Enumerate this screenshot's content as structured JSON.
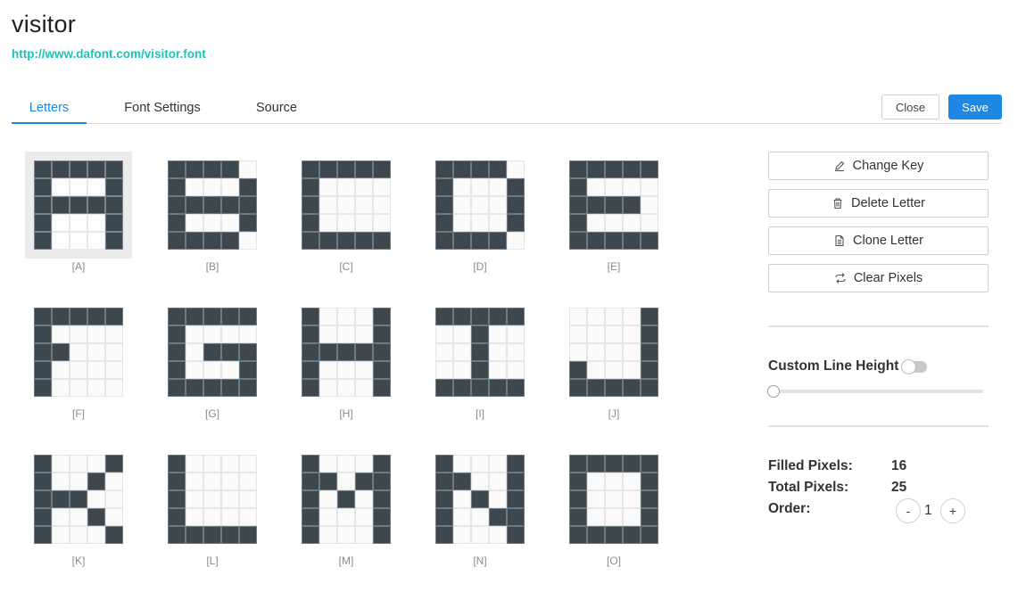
{
  "header": {
    "title": "visitor",
    "link": "http://www.dafont.com/visitor.font"
  },
  "tabs": [
    {
      "label": "Letters",
      "active": true
    },
    {
      "label": "Font Settings",
      "active": false
    },
    {
      "label": "Source",
      "active": false
    }
  ],
  "toolbar": {
    "close_label": "Close",
    "save_label": "Save"
  },
  "letters": [
    {
      "label": "[A]",
      "selected": true,
      "pixels": [
        "11111",
        "10001",
        "11111",
        "10001",
        "10001"
      ]
    },
    {
      "label": "[B]",
      "selected": false,
      "pixels": [
        "11110",
        "10001",
        "11111",
        "10001",
        "11110"
      ]
    },
    {
      "label": "[C]",
      "selected": false,
      "pixels": [
        "11111",
        "10000",
        "10000",
        "10000",
        "11111"
      ]
    },
    {
      "label": "[D]",
      "selected": false,
      "pixels": [
        "11110",
        "10001",
        "10001",
        "10001",
        "11110"
      ]
    },
    {
      "label": "[E]",
      "selected": false,
      "pixels": [
        "11111",
        "10000",
        "11110",
        "10000",
        "11111"
      ]
    },
    {
      "label": "[F]",
      "selected": false,
      "pixels": [
        "11111",
        "10000",
        "11000",
        "10000",
        "10000"
      ]
    },
    {
      "label": "[G]",
      "selected": false,
      "pixels": [
        "11111",
        "10000",
        "10111",
        "10001",
        "11111"
      ]
    },
    {
      "label": "[H]",
      "selected": false,
      "pixels": [
        "10001",
        "10001",
        "11111",
        "10001",
        "10001"
      ]
    },
    {
      "label": "[I]",
      "selected": false,
      "pixels": [
        "11111",
        "00100",
        "00100",
        "00100",
        "11111"
      ]
    },
    {
      "label": "[J]",
      "selected": false,
      "pixels": [
        "00001",
        "00001",
        "00001",
        "10001",
        "11111"
      ]
    },
    {
      "label": "[K]",
      "selected": false,
      "pixels": [
        "10001",
        "10010",
        "11100",
        "10010",
        "10001"
      ]
    },
    {
      "label": "[L]",
      "selected": false,
      "pixels": [
        "10000",
        "10000",
        "10000",
        "10000",
        "11111"
      ]
    },
    {
      "label": "[M]",
      "selected": false,
      "pixels": [
        "10001",
        "11011",
        "10101",
        "10001",
        "10001"
      ]
    },
    {
      "label": "[N]",
      "selected": false,
      "pixels": [
        "10001",
        "11001",
        "10101",
        "10011",
        "10001"
      ]
    },
    {
      "label": "[O]",
      "selected": false,
      "pixels": [
        "11111",
        "10001",
        "10001",
        "10001",
        "11111"
      ]
    }
  ],
  "actions": [
    {
      "label": "Change Key",
      "icon": "pencil-icon"
    },
    {
      "label": "Delete Letter",
      "icon": "trash-icon"
    },
    {
      "label": "Clone Letter",
      "icon": "document-icon"
    },
    {
      "label": "Clear Pixels",
      "icon": "swap-icon"
    }
  ],
  "line_height": {
    "label": "Custom Line Height",
    "enabled": false,
    "slider_fraction": 0
  },
  "stats": {
    "filled_label": "Filled Pixels:",
    "filled_value": "16",
    "total_label": "Total Pixels:",
    "total_value": "25",
    "order_label": "Order:",
    "order_value": "1",
    "decrement_label": "-",
    "increment_label": "+"
  },
  "colors": {
    "accent": "#1e88e5",
    "link": "#1ec5b6",
    "pixel_on": "#3d474e"
  }
}
